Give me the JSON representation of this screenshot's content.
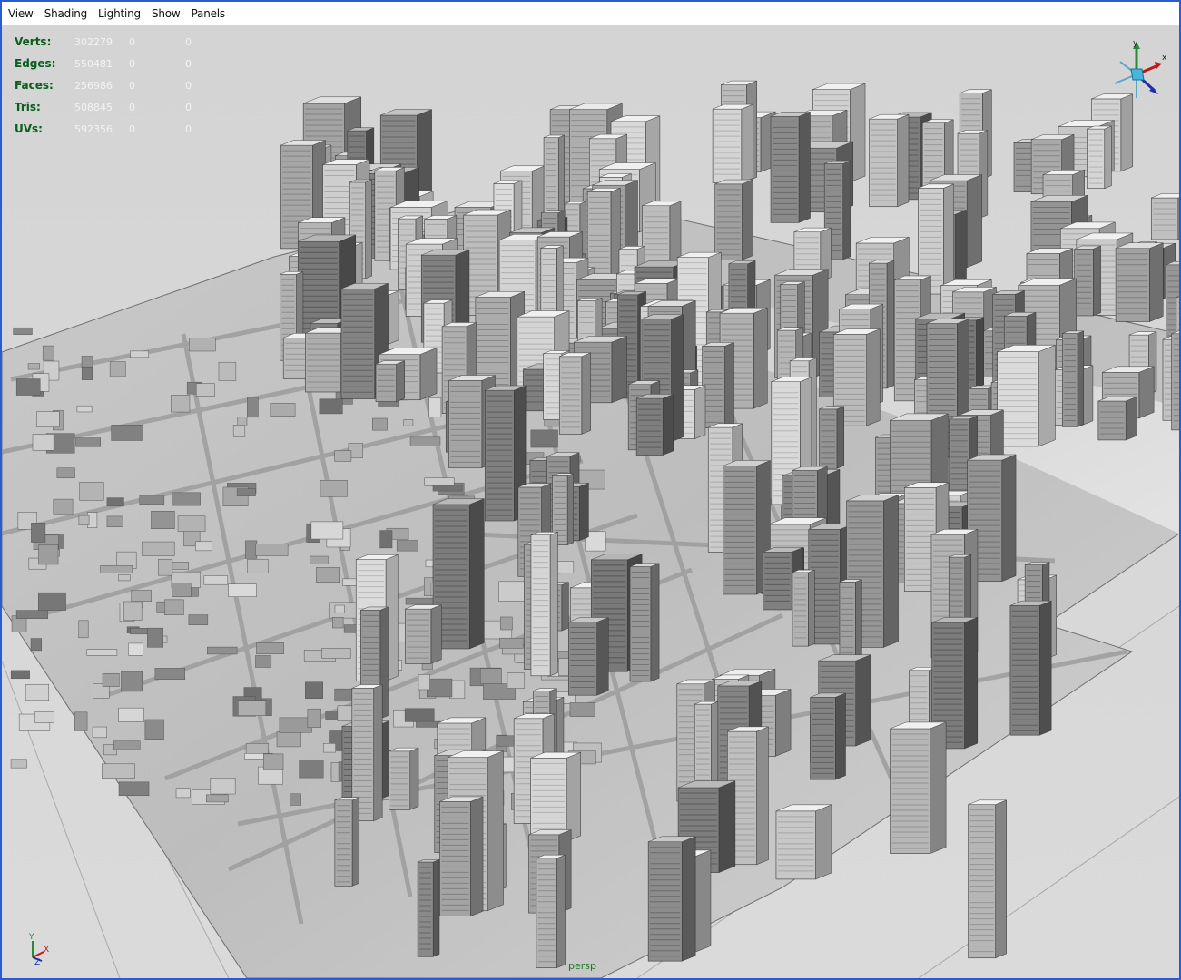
{
  "menubar": {
    "items": [
      "View",
      "Shading",
      "Lighting",
      "Show",
      "Panels"
    ]
  },
  "hud": {
    "rows": [
      {
        "label": "Verts:",
        "v1": "302279",
        "v2": "0",
        "v3": "0"
      },
      {
        "label": "Edges:",
        "v1": "550481",
        "v2": "0",
        "v3": "0"
      },
      {
        "label": "Faces:",
        "v1": "256986",
        "v2": "0",
        "v3": "0"
      },
      {
        "label": "Tris:",
        "v1": "508845",
        "v2": "0",
        "v3": "0"
      },
      {
        "label": "UVs:",
        "v1": "592356",
        "v2": "0",
        "v3": "0"
      }
    ]
  },
  "view_cube": {
    "axis_y": "y",
    "axis_x": "x"
  },
  "corner_axis": {
    "y": "Y",
    "x": "X",
    "z": "Z"
  },
  "camera": {
    "name": "persp"
  },
  "colors": {
    "window_border": "#2a5bd7",
    "viewport_bg": "#d6d6d6",
    "hud_label": "#0f5b22",
    "hud_value": "#f2f2f2"
  }
}
